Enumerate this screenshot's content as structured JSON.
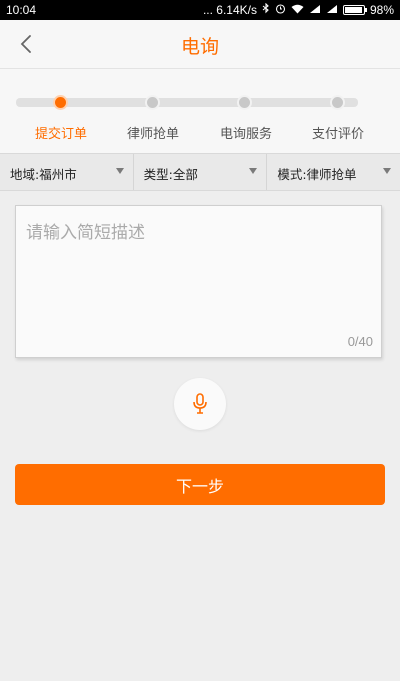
{
  "status_bar": {
    "time": "10:04",
    "network_speed": "... 6.14K/s",
    "battery_percent": "98%",
    "battery_level": 0.98,
    "icons": [
      "bluetooth-icon",
      "alarm-icon",
      "wifi-icon",
      "signal-icon",
      "signal-icon",
      "battery-icon"
    ]
  },
  "header": {
    "title": "电询",
    "back_icon": "chevron-left-icon"
  },
  "steps": [
    {
      "label": "提交订单",
      "active": true
    },
    {
      "label": "律师抢单",
      "active": false
    },
    {
      "label": "电询服务",
      "active": false
    },
    {
      "label": "支付评价",
      "active": false
    }
  ],
  "filters": [
    {
      "label": "地域:福州市"
    },
    {
      "label": "类型:全部"
    },
    {
      "label": "模式:律师抢单"
    }
  ],
  "description": {
    "placeholder": "请输入简短描述",
    "value": "",
    "counter": "0/40"
  },
  "mic": {
    "icon": "microphone-icon"
  },
  "next_button": {
    "label": "下一步"
  },
  "colors": {
    "accent": "#ff6d00",
    "background": "#eeeeee",
    "header_background": "#f7f7f7"
  }
}
